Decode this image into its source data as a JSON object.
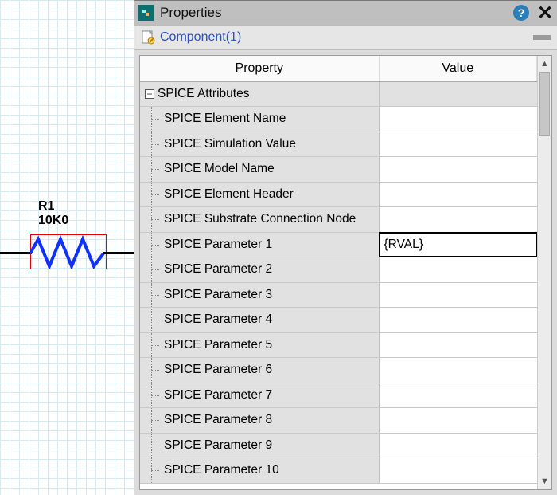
{
  "canvas": {
    "component_ref": "R1",
    "component_value": "10K0"
  },
  "panel": {
    "title": "Properties",
    "sub_link": "Component(1)",
    "columns": {
      "property": "Property",
      "value": "Value"
    },
    "group": {
      "label": "SPICE Attributes",
      "expanded": true
    },
    "rows": [
      {
        "label": "SPICE Element Name",
        "value": ""
      },
      {
        "label": "SPICE Simulation Value",
        "value": ""
      },
      {
        "label": "SPICE Model Name",
        "value": ""
      },
      {
        "label": "SPICE Element Header",
        "value": ""
      },
      {
        "label": "SPICE Substrate Connection Node",
        "value": ""
      },
      {
        "label": "SPICE Parameter 1",
        "value": "{RVAL}",
        "editing": true
      },
      {
        "label": "SPICE Parameter 2",
        "value": ""
      },
      {
        "label": "SPICE Parameter 3",
        "value": ""
      },
      {
        "label": "SPICE Parameter 4",
        "value": ""
      },
      {
        "label": "SPICE Parameter 5",
        "value": ""
      },
      {
        "label": "SPICE Parameter 6",
        "value": ""
      },
      {
        "label": "SPICE Parameter 7",
        "value": ""
      },
      {
        "label": "SPICE Parameter 8",
        "value": ""
      },
      {
        "label": "SPICE Parameter 9",
        "value": ""
      },
      {
        "label": "SPICE Parameter 10",
        "value": ""
      }
    ]
  },
  "icons": {
    "help": "?",
    "close": "✕",
    "minus": "−",
    "arrow_up": "▲",
    "arrow_down": "▼"
  }
}
